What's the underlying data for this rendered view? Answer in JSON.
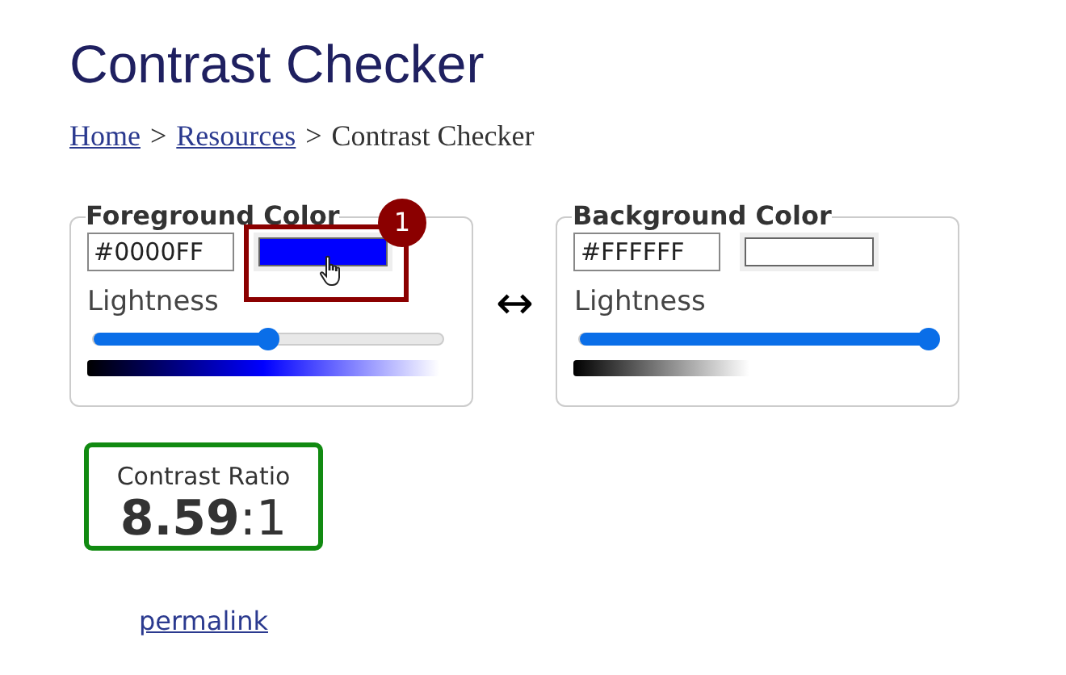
{
  "title": "Contrast Checker",
  "breadcrumb": [
    {
      "label": "Home",
      "link": true
    },
    {
      "label": ">",
      "link": false
    },
    {
      "label": "Resources",
      "link": true
    },
    {
      "label": ">",
      "link": false
    },
    {
      "label": "Contrast Checker",
      "link": false
    }
  ],
  "panels": [
    {
      "legend": "Foreground Color",
      "hex": "#0000FF",
      "color": "#0000ff",
      "lightness_label": "Lightness",
      "level": 0.5,
      "highlighted": true,
      "badge": "1"
    },
    {
      "legend": "Background Color",
      "hex": "#FFFFFF",
      "color": "#ffffff",
      "lightness_label": "Lightness",
      "level": 1.0,
      "highlighted": false
    }
  ],
  "swap": "↔",
  "ratio": {
    "label": "Contrast Ratio",
    "value": "**8.59**:1"
  },
  "permalink": "permalink"
}
